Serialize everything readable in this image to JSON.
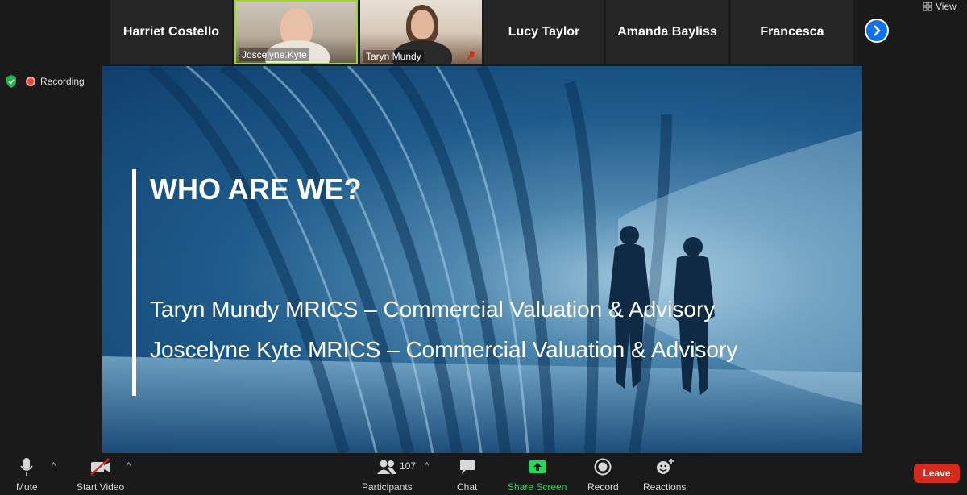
{
  "participants_strip": {
    "tiles": [
      {
        "name": "Harriet Costello"
      },
      {
        "name": "Joscelyne.Kyte"
      },
      {
        "name": "Taryn Mundy"
      },
      {
        "name": "Lucy Taylor"
      },
      {
        "name": "Amanda Bayliss"
      },
      {
        "name": "Francesca"
      }
    ]
  },
  "top_right": {
    "view_label": "View"
  },
  "status": {
    "recording_label": "Recording"
  },
  "slide": {
    "title": "WHO ARE WE?",
    "lines": [
      "Taryn Mundy MRICS – Commercial Valuation & Advisory",
      "Joscelyne Kyte MRICS – Commercial Valuation & Advisory"
    ]
  },
  "toolbar": {
    "mute_label": "Mute",
    "start_video_label": "Start Video",
    "participants_label": "Participants",
    "participants_count": "107",
    "chat_label": "Chat",
    "share_screen_label": "Share Screen",
    "record_label": "Record",
    "reactions_label": "Reactions",
    "leave_label": "Leave"
  },
  "colors": {
    "background": "#1a1a1a",
    "tile": "#262626",
    "active_speaker_border": "#9ed82a",
    "share_green": "#23d959",
    "leave_red": "#d52b1e",
    "accent_blue": "#0e71eb"
  },
  "icons": [
    "shield-icon",
    "recording-icon",
    "chevron-right-icon",
    "view-grid-icon",
    "microphone-icon",
    "video-off-icon",
    "participants-icon",
    "chat-icon",
    "share-screen-icon",
    "record-icon",
    "reactions-icon",
    "mic-muted-icon"
  ]
}
